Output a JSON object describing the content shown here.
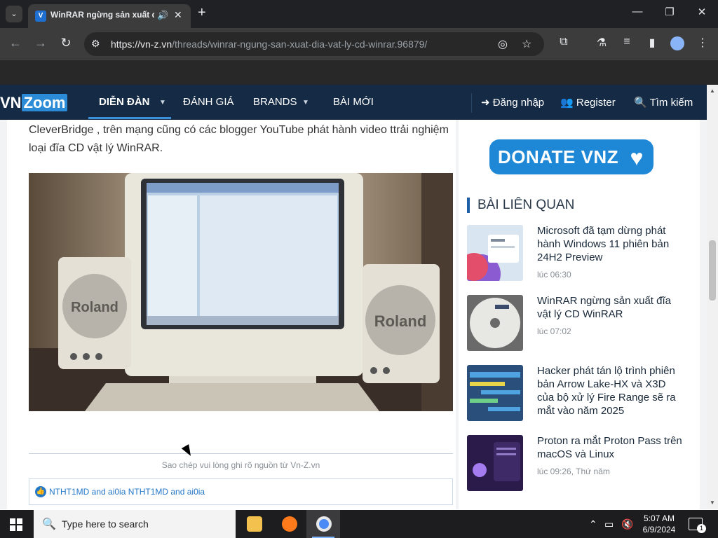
{
  "browser": {
    "tab_title": "WinRAR ngừng sản xuất đĩa vật lý CD WinRAR",
    "tab_favicon": "VNZ",
    "url_domain": "https://vn-z.vn",
    "url_path": "/threads/winrar-ngung-san-xuat-dia-vat-ly-cd-winrar.96879/"
  },
  "site": {
    "logo_vn": "VN",
    "logo_zoom": "Zoom",
    "nav": {
      "forum": "DIỄN ĐÀN",
      "review": "ĐÁNH GIÁ",
      "brands": "BRANDS",
      "new_posts": "BÀI MỚI",
      "login": "Đăng nhập",
      "register": "Register",
      "search": "Tìm kiếm"
    }
  },
  "article": {
    "paragraph": "CleverBridge , trên mạng cũng có các blogger YouTube phát hành video ttrải nghiệm loại đĩa CD vật lý WinRAR.",
    "speaker_left_label": "Roland",
    "speaker_right_label": "Roland",
    "caption": "Sao chép vui lòng ghi rõ nguồn từ Vn-Z.vn",
    "reactions_text": "NTHT1MD and ai0ia NTHT1MD and ai0ia"
  },
  "sidebar": {
    "donate": "DONATE VNZ",
    "related_title": "BÀI LIÊN QUAN",
    "related": [
      {
        "title": "Microsoft đã tạm dừng phát hành Windows 11 phiên bản 24H2 Preview",
        "time": "lúc 06:30"
      },
      {
        "title": "WinRAR ngừng sản xuất đĩa vật lý CD WinRAR",
        "time": "lúc 07:02"
      },
      {
        "title": "Hacker phát tán lộ trình phiên bản Arrow Lake-HX và X3D của bộ xử lý Fire Range sẽ ra mắt vào năm 2025",
        "time": ""
      },
      {
        "title": "Proton ra mắt Proton Pass trên macOS và Linux",
        "time": "lúc 09:26, Thứ năm"
      }
    ]
  },
  "taskbar": {
    "search_placeholder": "Type here to search",
    "time": "5:07 AM",
    "date": "6/9/2024",
    "notification_count": "1"
  },
  "colors": {
    "site_nav": "#152a44",
    "accent": "#1e88d6",
    "browser_dark": "#202124"
  }
}
